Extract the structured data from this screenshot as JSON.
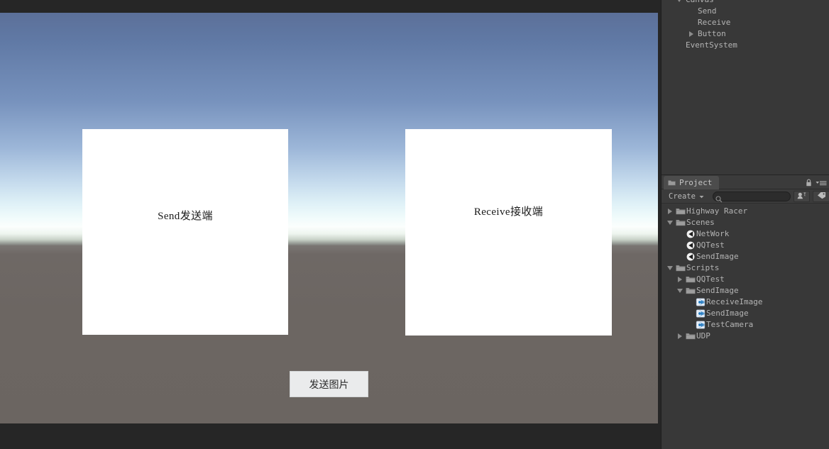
{
  "app": {
    "name": "Unity Editor",
    "theme": "dark"
  },
  "colors": {
    "panel_bg": "#383838",
    "toolbar_bg": "#3b3b3b",
    "tab_active_bg": "#4c4c4c",
    "text": "#b4b4b4",
    "editor_bg": "#262626",
    "game_ground": "#6d6763",
    "game_sky_top": "#5c7099",
    "game_sky_horizon": "#fbfefd",
    "panel_white": "#ffffff",
    "button_bg": "#eaebec"
  },
  "game_view": {
    "send_panel": {
      "label": "Send发送端",
      "icon": "image-placeholder"
    },
    "receive_panel": {
      "label": "Receive接收端",
      "icon": "image-placeholder"
    },
    "send_button": {
      "label": "发送图片"
    }
  },
  "hierarchy": {
    "items": [
      {
        "label": "Canvas",
        "depth": 0,
        "arrow": "down",
        "icon": "none"
      },
      {
        "label": "Send",
        "depth": 1,
        "arrow": "none",
        "icon": "none"
      },
      {
        "label": "Receive",
        "depth": 1,
        "arrow": "none",
        "icon": "none"
      },
      {
        "label": "Button",
        "depth": 1,
        "arrow": "right",
        "icon": "none"
      },
      {
        "label": "EventSystem",
        "depth": 0,
        "arrow": "none",
        "icon": "none"
      }
    ]
  },
  "project": {
    "tab": {
      "label": "Project",
      "icon": "folder-icon"
    },
    "tab_icons": {
      "lock": "lock-icon",
      "menu": "hamburger-menu-icon"
    },
    "toolbar": {
      "create_label": "Create",
      "create_arrow": "chevron-down-icon",
      "search_placeholder": "",
      "search_value": "",
      "search_icon": "search-icon",
      "filter_by_type_icon": "filter-type-icon",
      "filter_by_label_icon": "filter-label-icon"
    },
    "tree": [
      {
        "label": "Highway Racer",
        "depth": 0,
        "arrow": "right",
        "icon": "folder-icon"
      },
      {
        "label": "Scenes",
        "depth": 0,
        "arrow": "down",
        "icon": "folder-icon"
      },
      {
        "label": "NetWork",
        "depth": 1,
        "arrow": "none",
        "icon": "unity-scene-icon"
      },
      {
        "label": "QQTest",
        "depth": 1,
        "arrow": "none",
        "icon": "unity-scene-icon"
      },
      {
        "label": "SendImage",
        "depth": 1,
        "arrow": "none",
        "icon": "unity-scene-icon"
      },
      {
        "label": "Scripts",
        "depth": 0,
        "arrow": "down",
        "icon": "folder-icon"
      },
      {
        "label": "QQTest",
        "depth": 1,
        "arrow": "right",
        "icon": "folder-icon"
      },
      {
        "label": "SendImage",
        "depth": 1,
        "arrow": "down",
        "icon": "folder-icon"
      },
      {
        "label": "ReceiveImage",
        "depth": 2,
        "arrow": "none",
        "icon": "csharp-script-icon"
      },
      {
        "label": "SendImage",
        "depth": 2,
        "arrow": "none",
        "icon": "csharp-script-icon"
      },
      {
        "label": "TestCamera",
        "depth": 2,
        "arrow": "none",
        "icon": "csharp-script-icon"
      },
      {
        "label": "UDP",
        "depth": 1,
        "arrow": "right",
        "icon": "folder-icon"
      }
    ]
  }
}
